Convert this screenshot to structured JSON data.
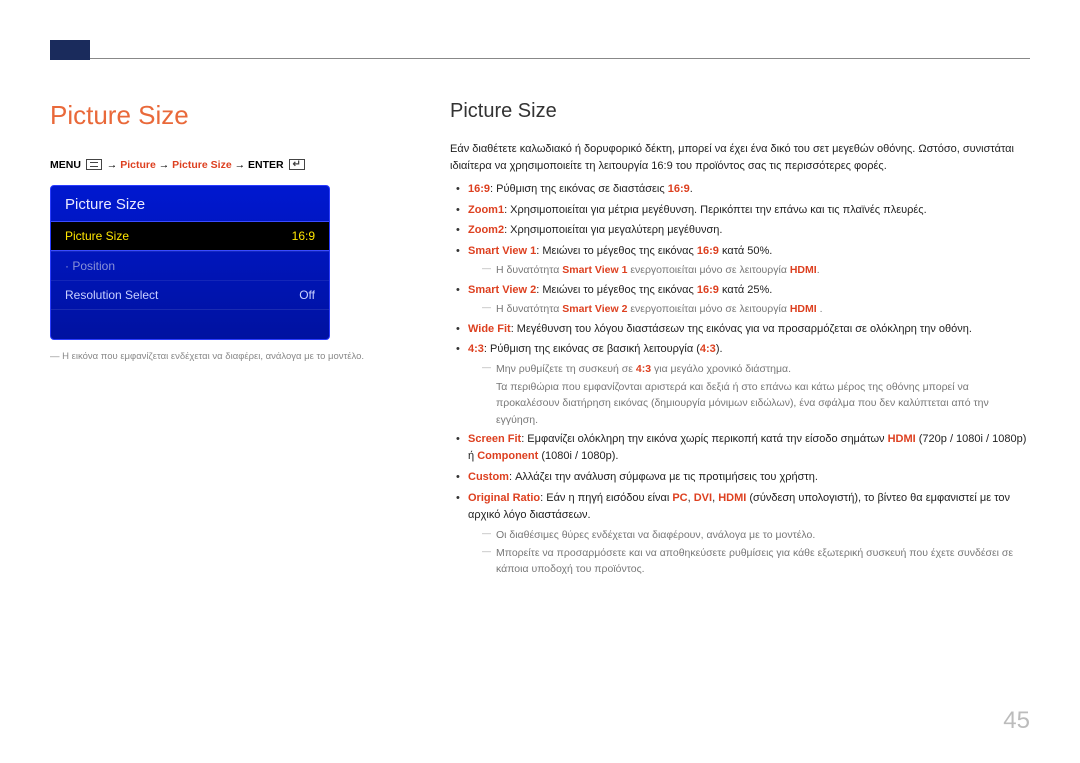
{
  "page_number": "45",
  "left": {
    "heading": "Picture Size",
    "breadcrumb": {
      "menu_label": "MENU",
      "seg1": "Picture",
      "seg2": "Picture Size",
      "enter_label": "ENTER"
    },
    "osd": {
      "title": "Picture Size",
      "row_picture_size": {
        "label": "Picture Size",
        "value": "16:9"
      },
      "row_position": {
        "label": "· Position",
        "value": ""
      },
      "row_resolution": {
        "label": "Resolution Select",
        "value": "Off"
      }
    },
    "footnote": "― Η εικόνα που εμφανίζεται ενδέχεται να διαφέρει, ανάλογα με το μοντέλο."
  },
  "right": {
    "heading": "Picture Size",
    "intro": "Εάν διαθέτετε καλωδιακό ή δορυφορικό δέκτη, μπορεί να έχει ένα δικό του σετ μεγεθών οθόνης. Ωστόσο, συνιστάται ιδιαίτερα να χρησιμοποιείτε τη λειτουργία 16:9 του προϊόντος σας τις περισσότερες φορές.",
    "items": {
      "i169": {
        "kw": "16:9",
        "text": ": Ρύθμιση της εικόνας σε διαστάσεις ",
        "tail_kw": "16:9",
        "tail": "."
      },
      "zoom1": {
        "kw": "Zoom1",
        "text": ": Χρησιμοποιείται για μέτρια μεγέθυνση. Περικόπτει την επάνω και τις πλαϊνές πλευρές."
      },
      "zoom2": {
        "kw": "Zoom2",
        "text": ": Χρησιμοποιείται για μεγαλύτερη μεγέθυνση."
      },
      "sv1": {
        "kw": "Smart View 1",
        "text": ": Μειώνει το μέγεθος της εικόνας ",
        "mid_kw": "16:9",
        "tail": " κατά 50%."
      },
      "sv1_note_a": "Η δυνατότητα ",
      "sv1_note_kw": "Smart View 1",
      "sv1_note_b": " ενεργοποιείται μόνο σε λειτουργία ",
      "sv1_note_kw2": "HDMI",
      "sv1_note_c": ".",
      "sv2": {
        "kw": "Smart View 2",
        "text": ": Μειώνει το μέγεθος της εικόνας ",
        "mid_kw": "16:9",
        "tail": " κατά 25%."
      },
      "sv2_note_a": "Η δυνατότητα ",
      "sv2_note_kw": "Smart View 2",
      "sv2_note_b": " ενεργοποιείται μόνο σε λειτουργία ",
      "sv2_note_kw2": "HDMI",
      "sv2_note_c": " .",
      "widefit": {
        "kw": "Wide Fit",
        "text": ": Μεγέθυνση του λόγου διαστάσεων της εικόνας για να προσαρμόζεται σε ολόκληρη την οθόνη."
      },
      "i43": {
        "kw": "4:3",
        "text": ": Ρύθμιση της εικόνας σε βασική λειτουργία (",
        "mid_kw": "4:3",
        "tail": ")."
      },
      "i43_note1_a": "Μην ρυθμίζετε τη συσκευή σε ",
      "i43_note1_kw": "4:3",
      "i43_note1_b": " για μεγάλο χρονικό διάστημα.",
      "i43_note2": "Τα περιθώρια που εμφανίζονται αριστερά και δεξιά ή στο επάνω και κάτω μέρος της οθόνης μπορεί να προκαλέσουν διατήρηση εικόνας (δημιουργία μόνιμων ειδώλων), ένα σφάλμα που δεν καλύπτεται από την εγγύηση.",
      "screenfit_kw": "Screen Fit",
      "screenfit_a": ": Εμφανίζει ολόκληρη την εικόνα χωρίς περικοπή κατά την είσοδο σημάτων ",
      "screenfit_kw2": "HDMI",
      "screenfit_b": " (720p / 1080i / 1080p) ή ",
      "screenfit_kw3": "Component",
      "screenfit_c": " (1080i / 1080p).",
      "custom": {
        "kw": "Custom",
        "text": ": Αλλάζει την ανάλυση σύμφωνα με τις προτιμήσεις του χρήστη."
      },
      "orig_kw": "Original Ratio",
      "orig_a": ": Εάν η πηγή εισόδου είναι ",
      "orig_kw2": "PC",
      "orig_sep": ", ",
      "orig_kw3": "DVI",
      "orig_kw4": "HDMI",
      "orig_b": " (σύνδεση υπολογιστή), το βίντεο θα εμφανιστεί με τον αρχικό λόγο διαστάσεων.",
      "orig_note1": "Οι διαθέσιμες θύρες ενδέχεται να διαφέρουν, ανάλογα με το μοντέλο.",
      "orig_note2": "Μπορείτε να προσαρμόσετε και να αποθηκεύσετε ρυθμίσεις για κάθε εξωτερική συσκευή που έχετε συνδέσει σε κάποια υποδοχή του προϊόντος."
    }
  }
}
